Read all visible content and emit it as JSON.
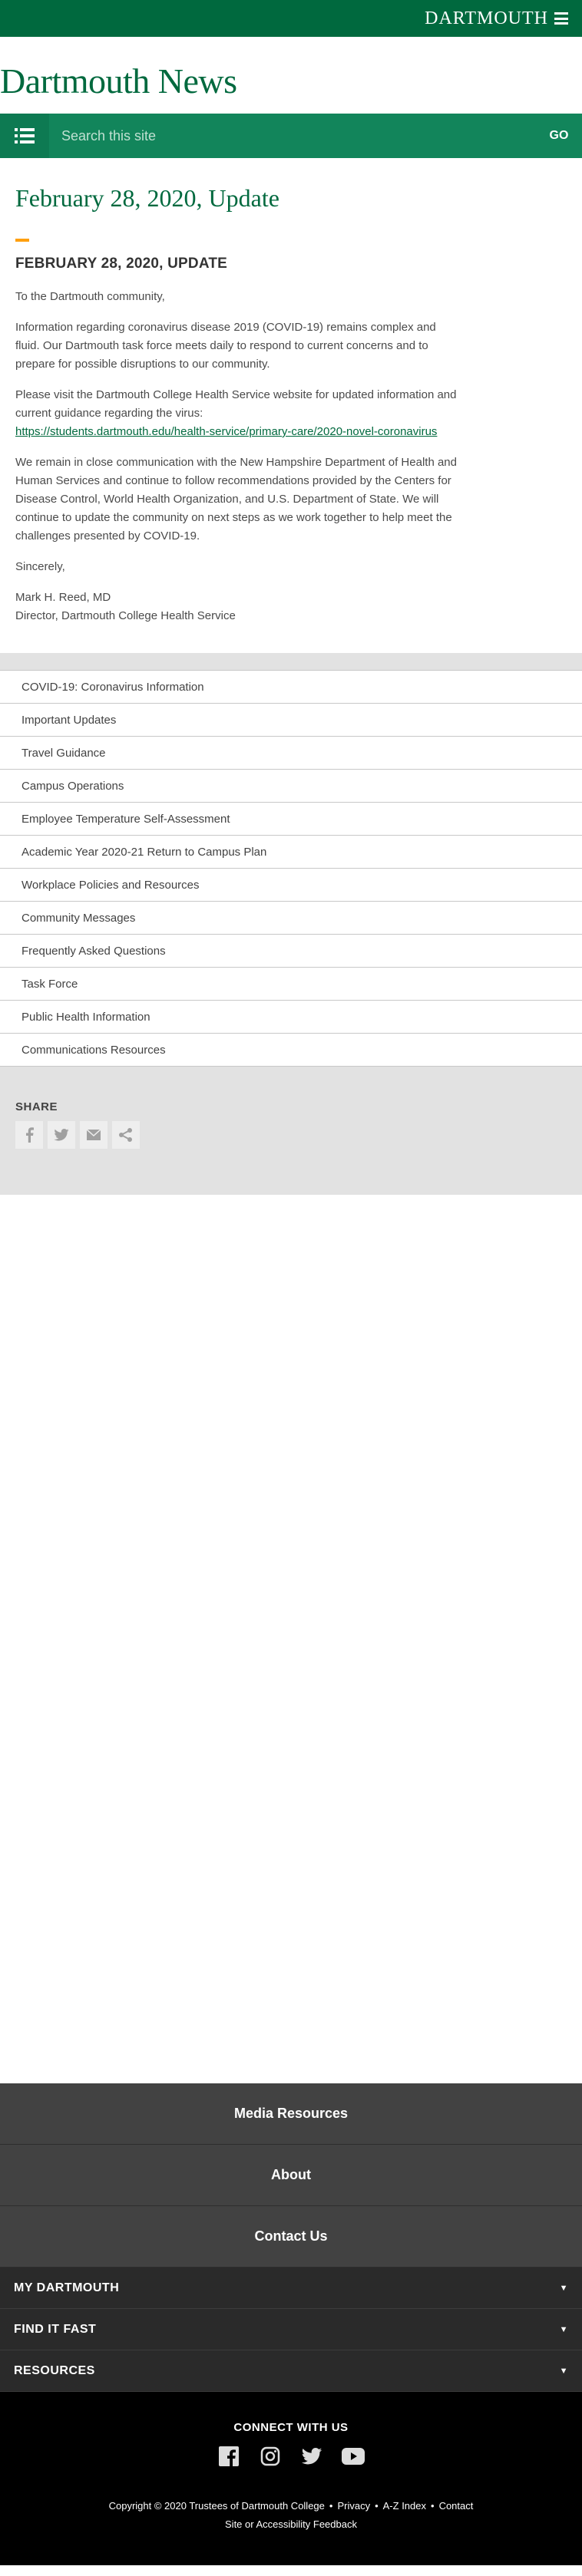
{
  "brand": {
    "wordmark": "DARTMOUTH"
  },
  "site": {
    "title": "Dartmouth News"
  },
  "search": {
    "placeholder": "Search this site",
    "go_label": "GO"
  },
  "article": {
    "title": "February 28, 2020, Update",
    "heading": "FEBRUARY 28, 2020, UPDATE",
    "greeting": "To the Dartmouth community,",
    "p1": "Information regarding coronavirus disease 2019 (COVID-19) remains complex and fluid. Our Dartmouth task force meets daily to respond to current concerns and to prepare for possible disruptions to our community.",
    "p2": "Please visit the Dartmouth College Health Service website for updated information and current guidance regarding the virus:",
    "link": "https://students.dartmouth.edu/health-service/primary-care/2020-novel-coronavirus",
    "p3": "We remain in close communication with the New Hampshire Department of Health and Human Services and continue to follow recommendations provided by the Centers for Disease Control, World Health Organization, and U.S. Department of State. We will continue to update the community on next steps as we work together to help meet the challenges presented by COVID-19.",
    "closing": "Sincerely,",
    "signer_name": "Mark H. Reed, MD",
    "signer_title": "Director, Dartmouth College Health Service"
  },
  "related": [
    {
      "label": "COVID-19: Coronavirus Information"
    },
    {
      "label": "Important Updates"
    },
    {
      "label": "Travel Guidance"
    },
    {
      "label": "Campus Operations"
    },
    {
      "label": "Employee Temperature Self-Assessment"
    },
    {
      "label": "Academic Year 2020-21 Return to Campus Plan"
    },
    {
      "label": "Workplace Policies and Resources"
    },
    {
      "label": "Community Messages"
    },
    {
      "label": "Frequently Asked Questions"
    },
    {
      "label": "Task Force"
    },
    {
      "label": "Public Health Information"
    },
    {
      "label": "Communications Resources"
    }
  ],
  "share": {
    "label": "SHARE"
  },
  "footer": {
    "links": [
      {
        "label": "Media Resources"
      },
      {
        "label": "About"
      },
      {
        "label": "Contact Us"
      }
    ],
    "accordions": [
      {
        "label": "MY DARTMOUTH"
      },
      {
        "label": "FIND IT FAST"
      },
      {
        "label": "RESOURCES"
      }
    ],
    "connect": "CONNECT WITH US",
    "copyright": "Copyright © 2020 Trustees of Dartmouth College",
    "privacy": "Privacy",
    "az_index": "A-Z Index",
    "contact": "Contact",
    "feedback": "Site or Accessibility Feedback",
    "bullet": "•"
  },
  "colors": {
    "brand_green": "#00693e",
    "search_green": "#12855b",
    "accent": "#ffa00f"
  }
}
